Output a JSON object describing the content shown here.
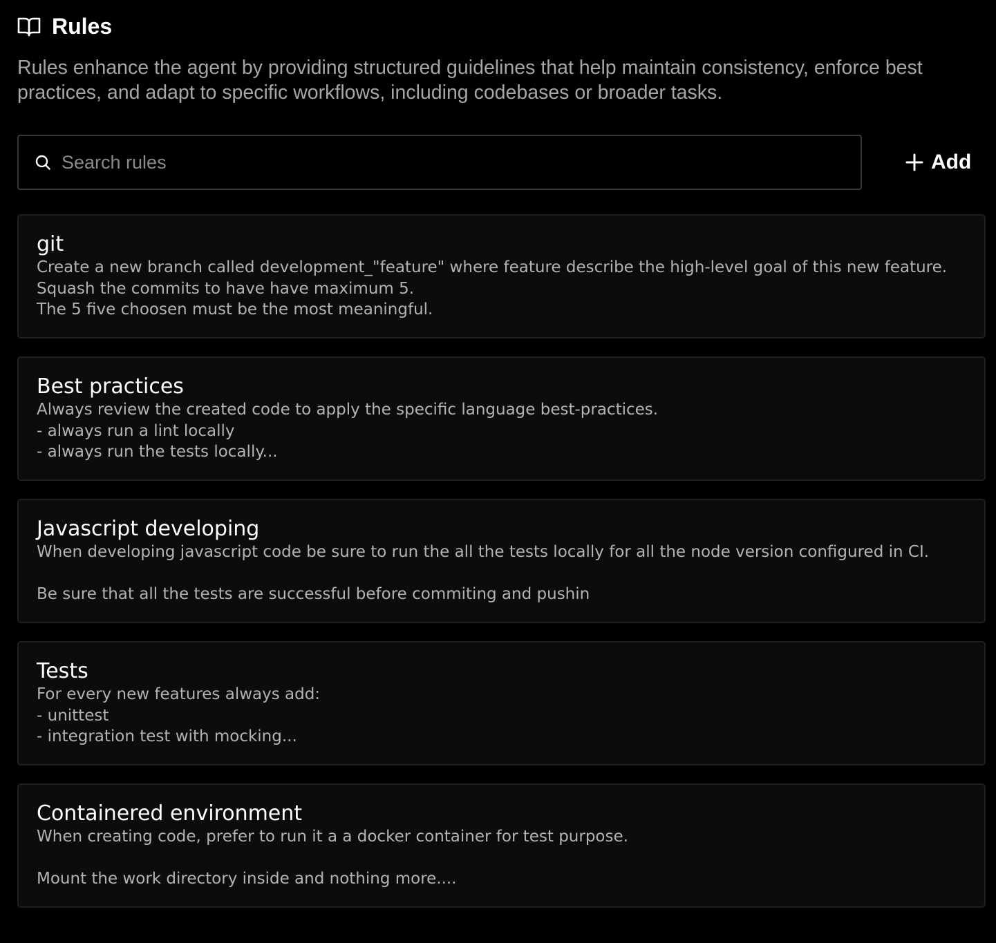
{
  "header": {
    "title": "Rules",
    "icon": "book-open-icon"
  },
  "description": "Rules enhance the agent by providing structured guidelines that help maintain consistency, enforce best practices, and adapt to specific workflows, including codebases or broader tasks.",
  "search": {
    "placeholder": "Search rules",
    "value": "",
    "icon": "search-icon"
  },
  "add_button": {
    "label": "Add",
    "icon": "plus-icon"
  },
  "rules": [
    {
      "title": "git",
      "body": "Create a new branch called development_\"feature\" where feature describe the high-level goal of this new feature.\nSquash the commits to have have maximum 5.\nThe 5 five choosen must be the most meaningful."
    },
    {
      "title": "Best practices",
      "body": "Always review the created code to apply the specific language best-practices.\n- always run a lint locally\n- always run the tests locally..."
    },
    {
      "title": "Javascript developing",
      "body": "When developing javascript code be sure to run the all the tests locally for all the node version configured in CI.\n\nBe sure that all the tests are successful before commiting and pushin"
    },
    {
      "title": "Tests",
      "body": "For every new features always add:\n- unittest\n- integration test with mocking..."
    },
    {
      "title": "Containered environment",
      "body": "When creating code, prefer to run it a a docker container for test purpose.\n\nMount the work directory inside and nothing more...."
    }
  ],
  "colors": {
    "background": "#000000",
    "card_background": "#0c0c0c",
    "card_border": "#1f1f1f",
    "muted_text": "#a6a6a6"
  }
}
